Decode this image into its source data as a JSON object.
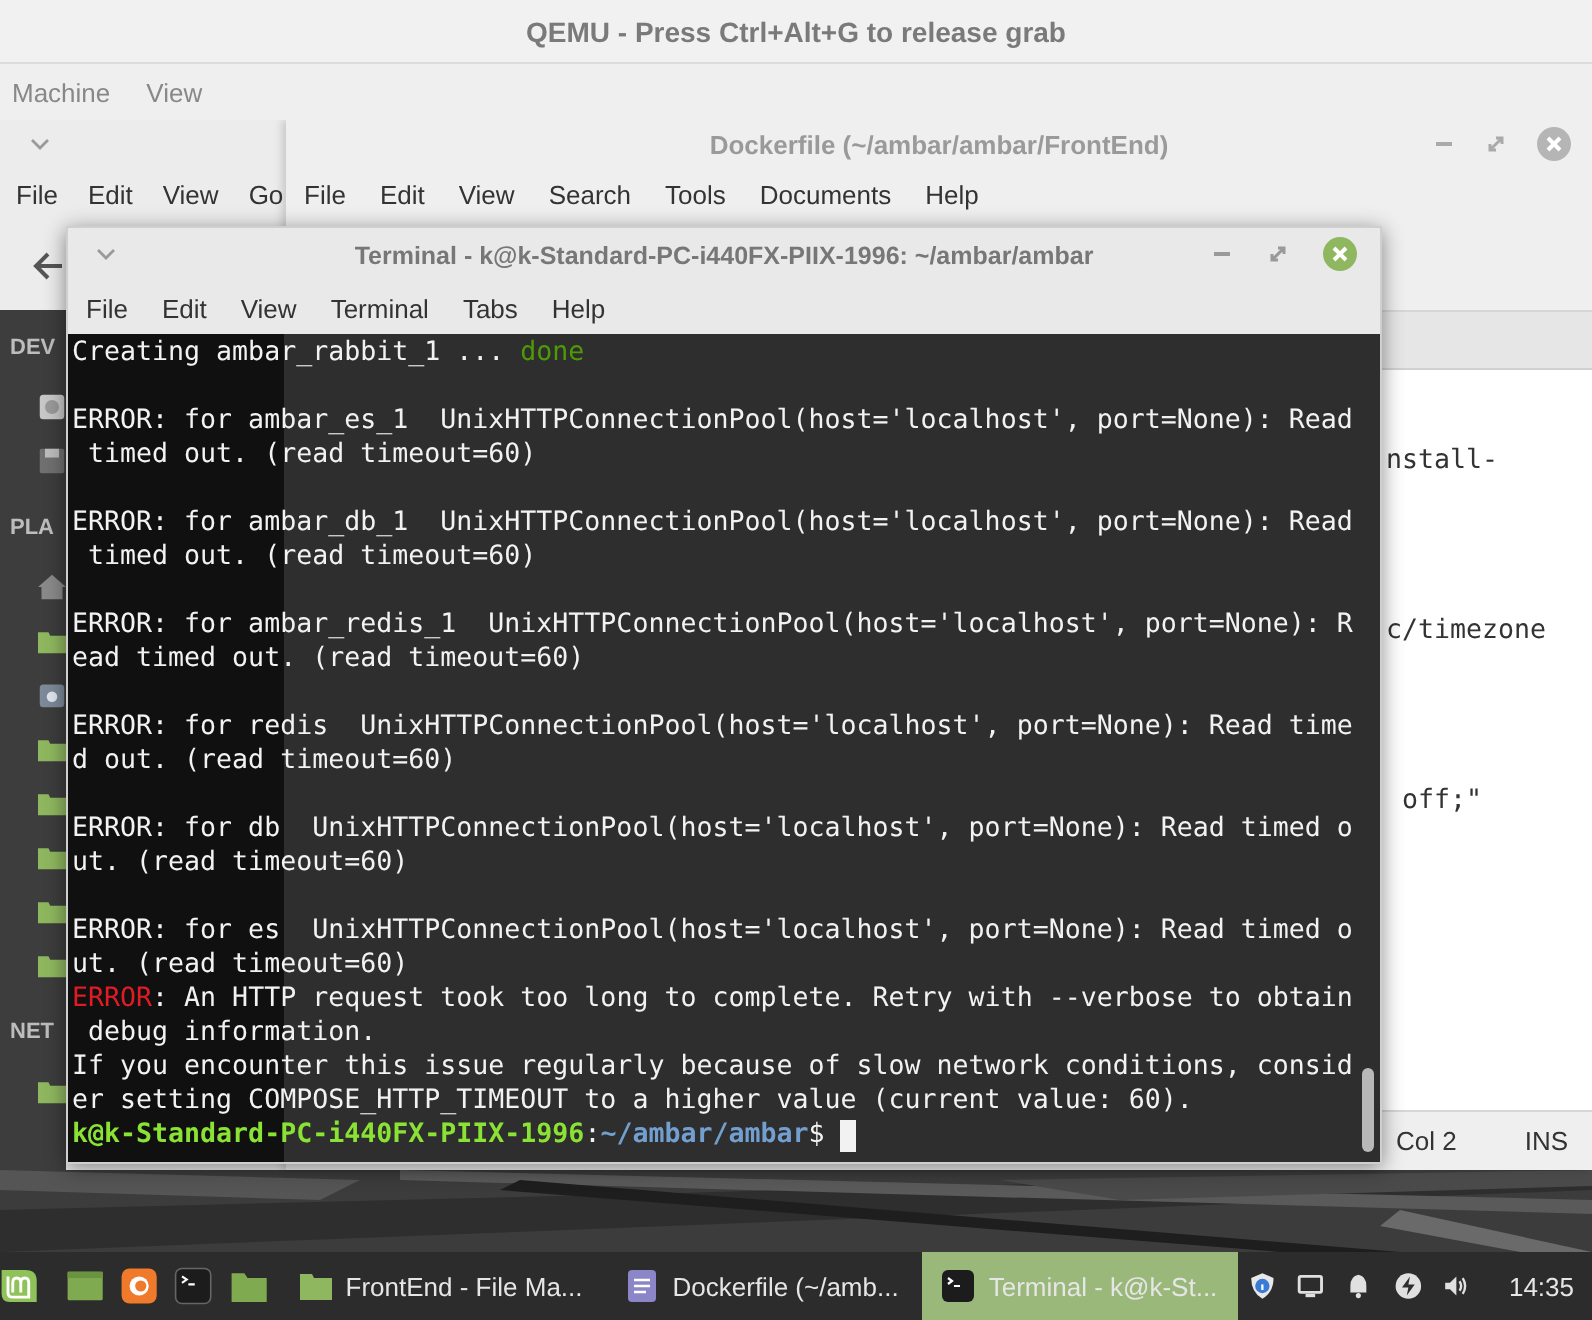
{
  "qemu": {
    "title": "QEMU - Press Ctrl+Alt+G to release grab",
    "menu": [
      "Machine",
      "View"
    ]
  },
  "file_manager": {
    "menu": [
      "File",
      "Edit",
      "View",
      "Go"
    ],
    "sidebar": [
      {
        "heading": "DEV"
      },
      {
        "heading": "PLA"
      },
      {
        "heading": "NET"
      }
    ]
  },
  "editor": {
    "title": "Dockerfile (~/ambar/ambar/FrontEnd)",
    "menu": [
      "File",
      "Edit",
      "View",
      "Search",
      "Tools",
      "Documents",
      "Help"
    ],
    "lines": [
      {
        "kind": "blank"
      },
      {
        "kind": "blank"
      },
      {
        "kind": "text",
        "text": "nstall-"
      },
      {
        "kind": "blank"
      },
      {
        "kind": "blank"
      },
      {
        "kind": "blank"
      },
      {
        "kind": "blank"
      },
      {
        "kind": "text",
        "text": "c/timezone"
      },
      {
        "kind": "blank"
      },
      {
        "kind": "blank"
      },
      {
        "kind": "blank"
      },
      {
        "kind": "blank"
      },
      {
        "kind": "text",
        "text": " off;\""
      }
    ],
    "status": [
      "Col 2",
      "INS"
    ]
  },
  "terminal": {
    "title": "Terminal - k@k-Standard-PC-i440FX-PIIX-1996: ~/ambar/ambar",
    "menu": [
      "File",
      "Edit",
      "View",
      "Terminal",
      "Tabs",
      "Help"
    ],
    "lines": [
      {
        "kind": "text",
        "segments": [
          {
            "text": "Creating ambar_rabbit_1 ... ",
            "kind": "plain"
          },
          {
            "text": "done",
            "kind": "success"
          }
        ]
      },
      {
        "kind": "blank"
      },
      {
        "kind": "text",
        "segments": [
          {
            "text": "ERROR: for ambar_es_1  UnixHTTPConnectionPool(host='localhost', port=None): Read",
            "kind": "plain"
          }
        ]
      },
      {
        "kind": "text",
        "segments": [
          {
            "text": " timed out. (read timeout=60)",
            "kind": "plain"
          }
        ]
      },
      {
        "kind": "blank"
      },
      {
        "kind": "text",
        "segments": [
          {
            "text": "ERROR: for ambar_db_1  UnixHTTPConnectionPool(host='localhost', port=None): Read",
            "kind": "plain"
          }
        ]
      },
      {
        "kind": "text",
        "segments": [
          {
            "text": " timed out. (read timeout=60)",
            "kind": "plain"
          }
        ]
      },
      {
        "kind": "blank"
      },
      {
        "kind": "text",
        "segments": [
          {
            "text": "ERROR: for ambar_redis_1  UnixHTTPConnectionPool(host='localhost', port=None): R",
            "kind": "plain"
          }
        ]
      },
      {
        "kind": "text",
        "segments": [
          {
            "text": "ead timed out. (read timeout=60)",
            "kind": "plain"
          }
        ]
      },
      {
        "kind": "blank"
      },
      {
        "kind": "text",
        "segments": [
          {
            "text": "ERROR: for redis  UnixHTTPConnectionPool(host='localhost', port=None): Read time",
            "kind": "plain"
          }
        ]
      },
      {
        "kind": "text",
        "segments": [
          {
            "text": "d out. (read timeout=60)",
            "kind": "plain"
          }
        ]
      },
      {
        "kind": "blank"
      },
      {
        "kind": "text",
        "segments": [
          {
            "text": "ERROR: for db  UnixHTTPConnectionPool(host='localhost', port=None): Read timed o",
            "kind": "plain"
          }
        ]
      },
      {
        "kind": "text",
        "segments": [
          {
            "text": "ut. (read timeout=60)",
            "kind": "plain"
          }
        ]
      },
      {
        "kind": "blank"
      },
      {
        "kind": "text",
        "segments": [
          {
            "text": "ERROR: for es  UnixHTTPConnectionPool(host='localhost', port=None): Read timed o",
            "kind": "plain"
          }
        ]
      },
      {
        "kind": "text",
        "segments": [
          {
            "text": "ut. (read timeout=60)",
            "kind": "plain"
          }
        ]
      },
      {
        "kind": "text",
        "segments": [
          {
            "text": "ERROR",
            "kind": "error"
          },
          {
            "text": ": An HTTP request took too long to complete. Retry with --verbose to obtain",
            "kind": "plain"
          }
        ]
      },
      {
        "kind": "text",
        "segments": [
          {
            "text": " debug information.",
            "kind": "plain"
          }
        ]
      },
      {
        "kind": "text",
        "segments": [
          {
            "text": "If you encounter this issue regularly because of slow network conditions, consid",
            "kind": "plain"
          }
        ]
      },
      {
        "kind": "text",
        "segments": [
          {
            "text": "er setting COMPOSE_HTTP_TIMEOUT to a higher value (current value: 60).",
            "kind": "plain"
          }
        ]
      },
      {
        "kind": "prompt",
        "segments": [
          {
            "text": "k@k-Standard-PC-i440FX-PIIX-1996",
            "kind": "user"
          },
          {
            "text": ":",
            "kind": "plain"
          },
          {
            "text": "~/ambar/ambar",
            "kind": "path"
          },
          {
            "text": "$ ",
            "kind": "plain"
          }
        ]
      }
    ]
  },
  "taskbar": {
    "windows": [
      {
        "label": "FrontEnd - File Ma...",
        "kind": "files",
        "selected": false
      },
      {
        "label": "Dockerfile (~/amb...",
        "kind": "editor",
        "selected": false
      },
      {
        "label": "Terminal - k@k-St...",
        "kind": "terminal",
        "selected": true
      }
    ],
    "clock": "14:35"
  }
}
